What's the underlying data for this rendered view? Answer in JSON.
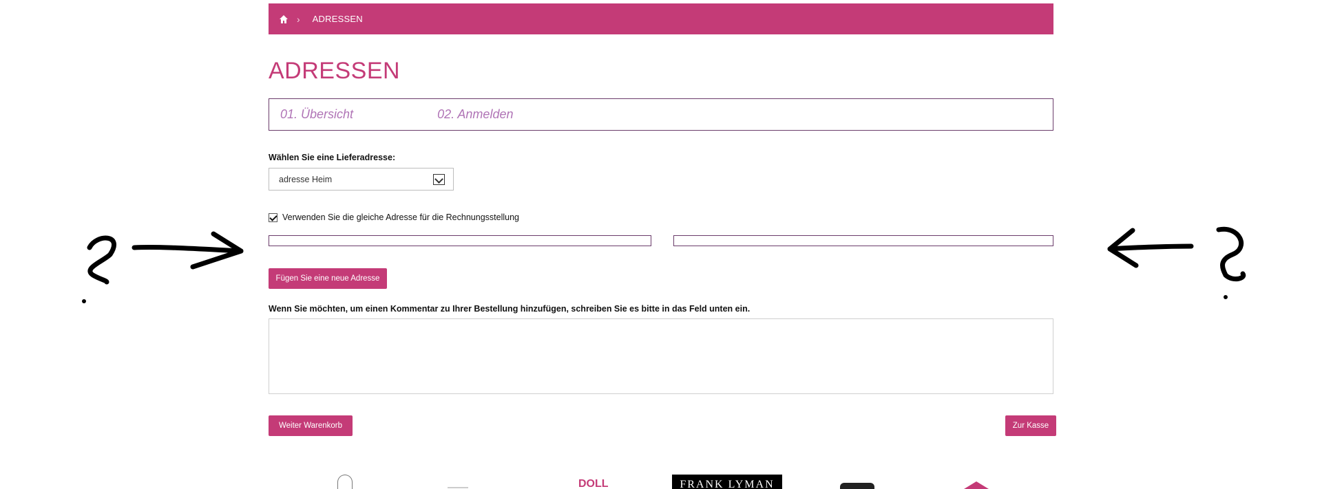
{
  "breadcrumb": {
    "home_icon": "home-icon",
    "separator": "›",
    "current": "ADRESSEN"
  },
  "page": {
    "title": "ADRESSEN"
  },
  "steps": [
    "01. Übersicht",
    "02. Anmelden"
  ],
  "delivery": {
    "label": "Wählen Sie eine Lieferadresse:",
    "selected": "adresse Heim"
  },
  "billing": {
    "same_address_label": "Verwenden Sie die gleiche Adresse für die Rechnungsstellung",
    "checked": true
  },
  "buttons": {
    "add_address": "Fügen Sie eine neue Adresse",
    "back_cart": "Weiter Warenkorb",
    "checkout": "Zur Kasse"
  },
  "comment": {
    "label": "Wenn Sie möchten, um einen Kommentar zu Ihrer Bestellung hinzufügen, schreiben Sie es bitte in das Feld unten ein."
  },
  "footer_logos": {
    "logo4_text": "FRANK LYMAN",
    "logo3_text": "DOLL"
  },
  "annotations": {
    "mark": "?"
  },
  "colors": {
    "brand": "#c43b77",
    "step_text": "#b074b6",
    "border_dark": "#6a3b6a"
  }
}
